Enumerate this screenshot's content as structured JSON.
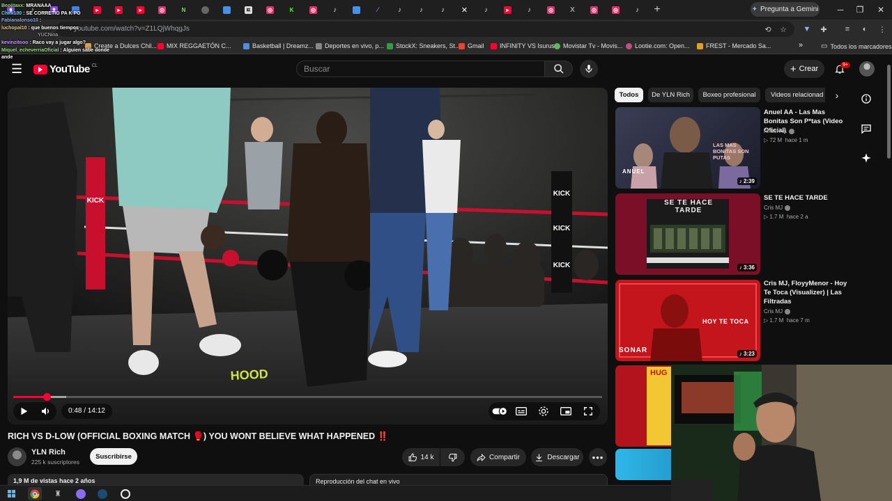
{
  "browser": {
    "tab_strip_labels": [
      "(",
      "N",
      "ㅌ",
      "F",
      "X"
    ],
    "gemini_button": "Pregunta a Gemini",
    "url": "youtube.com/watch?v=Z1LQjWhqgJs",
    "bookmarks": [
      {
        "label": "Create a Dulces Chil...",
        "color": "#d1a05a"
      },
      {
        "label": "MIX REGGAETÓN C...",
        "color": "#ff0033"
      },
      {
        "label": "Basketball | Dreamz...",
        "color": "#4a90e2"
      },
      {
        "label": "Deportes en vivo, p...",
        "color": "#888888"
      },
      {
        "label": "StockX: Sneakers, St...",
        "color": "#2ea043"
      },
      {
        "label": "Gmail",
        "color": "#ea4335"
      },
      {
        "label": "INFINITY VS Isurus",
        "color": "#ff0033"
      },
      {
        "label": "Movistar Tv - Movis...",
        "color": "#5cb85c"
      },
      {
        "label": "Lootie.com: Open...",
        "color": "#c05080"
      },
      {
        "label": "FREST - Mercado Sa...",
        "color": "#e0a030"
      }
    ],
    "bookmarks_overflow": "»",
    "all_bookmarks": "Todos los marcadores"
  },
  "stream_chat": [
    {
      "user": "Beojitaxx:",
      "msg": " MRANAAA"
    },
    {
      "user": "Chini100",
      "msg": " : SE CORRETIO PA K PO"
    },
    {
      "user": "Fabianalonso10",
      "msg": " : "
    },
    {
      "user": "luchopal10",
      "msg": " : que buenos tiempos"
    },
    {
      "user": "",
      "msg": "YUCNina"
    },
    {
      "user": "kevinzitooo",
      "msg": " : Raco vay a jugar algo?"
    },
    {
      "user": "Miquel_echeverriaOficial",
      "msg": " : Alguien sabe donde ande"
    }
  ],
  "yt_header": {
    "logo_text": "YouTube",
    "region": "CL",
    "search_placeholder": "Buscar",
    "create_label": "Crear",
    "notif_count": "9+"
  },
  "player": {
    "time": "0:48 / 14:12",
    "progress_fraction": 0.0563,
    "loaded_fraction": 0.09
  },
  "video": {
    "title": "RICH VS D-LOW (OFFICIAL BOXING MATCH 🥊) YOU WONT BELIEVE WHAT HAPPENED ‼️",
    "channel": "YLN Rich",
    "subs": "225 k suscriptores",
    "subscribe": "Suscribirse",
    "likes": "14 k",
    "share": "Compartir",
    "download": "Descargar",
    "views_strip": "1,9 M de vistas  hace 2 años",
    "chat_replay": "Reproducción del chat en vivo"
  },
  "sidebar": {
    "chips": [
      "Todos",
      "De YLN Rich",
      "Boxeo profesional",
      "Videos relacionad"
    ],
    "videos": [
      {
        "title": "Anuel AA - Las Mas Bonitas Son P*tas (Video Oficial)",
        "channel": "Anuel AA",
        "views": "72 M",
        "age": "hace 1 m",
        "duration": "2:39",
        "thumb_text": "LAS MAS BONITAS SON PUTAS",
        "brand": "ANUEL"
      },
      {
        "title": "SE TE HACE TARDE",
        "channel": "Cris MJ",
        "views": "1.7 M",
        "age": "hace 2 a",
        "duration": "3:36",
        "thumb_text": "SE TE HACE TARDE"
      },
      {
        "title": "Cris MJ, FloyyMenor - Hoy Te Toca (Visualizer) | Las Filtradas",
        "channel": "Cris MJ",
        "views": "1.7 M",
        "age": "hace 7 m",
        "duration": "3:23",
        "thumb_text": "HOY TE TOCA",
        "brand": "SONAR"
      },
      {
        "title": "",
        "channel": "",
        "views": "",
        "age": "",
        "duration": "",
        "thumb_text": "HUG"
      }
    ]
  },
  "colors": {
    "bg": "#0f0f0f",
    "accent": "#ff0033",
    "chip_active": "#f1f1f1"
  }
}
